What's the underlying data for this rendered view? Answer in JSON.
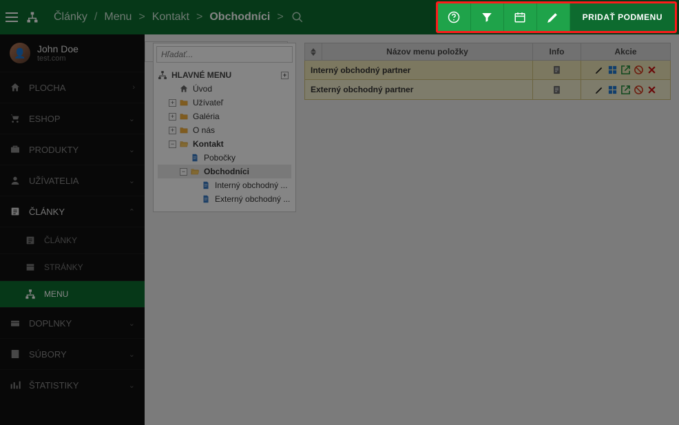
{
  "breadcrumbs": {
    "items": [
      "Články",
      "Menu",
      "Kontakt",
      "Obchodníci"
    ],
    "separator_slash": "/",
    "separator_arrow": ">"
  },
  "toolbar": {
    "add_label": "PRIDAŤ PODMENU"
  },
  "user": {
    "name": "John Doe",
    "domain": "test.com"
  },
  "sidebar": {
    "items": [
      {
        "label": "PLOCHA",
        "chev": "›"
      },
      {
        "label": "ESHOP",
        "chev": "⌄"
      },
      {
        "label": "PRODUKTY",
        "chev": "⌄"
      },
      {
        "label": "UŽÍVATELIA",
        "chev": "⌄"
      },
      {
        "label": "ČLÁNKY",
        "chev": "⌃",
        "expanded": true,
        "sub": [
          {
            "label": "ČLÁNKY"
          },
          {
            "label": "STRÁNKY"
          },
          {
            "label": "MENU",
            "active": true
          }
        ]
      },
      {
        "label": "DOPLNKY",
        "chev": "⌄"
      },
      {
        "label": "SÚBORY",
        "chev": "⌄"
      },
      {
        "label": "ŠTATISTIKY",
        "chev": "⌄"
      }
    ]
  },
  "tree": {
    "search_placeholder": "Hľadať...",
    "header": "HLAVNÉ MENU",
    "add_submenu": "PRIDAŤ PODMENU",
    "nodes": [
      {
        "label": "Úvod",
        "icon": "home",
        "depth": 1
      },
      {
        "label": "Užívateľ",
        "icon": "folder",
        "depth": 1,
        "tog": "+"
      },
      {
        "label": "Galéria",
        "icon": "folder",
        "depth": 1,
        "tog": "+"
      },
      {
        "label": "O nás",
        "icon": "folder",
        "depth": 1,
        "tog": "+"
      },
      {
        "label": "Kontakt",
        "icon": "folder-open",
        "depth": 1,
        "tog": "−",
        "bold": true
      },
      {
        "label": "Pobočky",
        "icon": "page",
        "depth": 2
      },
      {
        "label": "Obchodníci",
        "icon": "folder-open",
        "depth": 2,
        "tog": "−",
        "bold": true,
        "selected": true
      },
      {
        "label": "Interný obchodný ...",
        "icon": "page",
        "depth": 3
      },
      {
        "label": "Externý obchodný ...",
        "icon": "page",
        "depth": 3
      }
    ]
  },
  "table": {
    "headers": {
      "name": "Názov menu položky",
      "info": "Info",
      "actions": "Akcie"
    },
    "rows": [
      {
        "name": "Interný obchodný partner"
      },
      {
        "name": "Externý obchodný partner"
      }
    ]
  }
}
